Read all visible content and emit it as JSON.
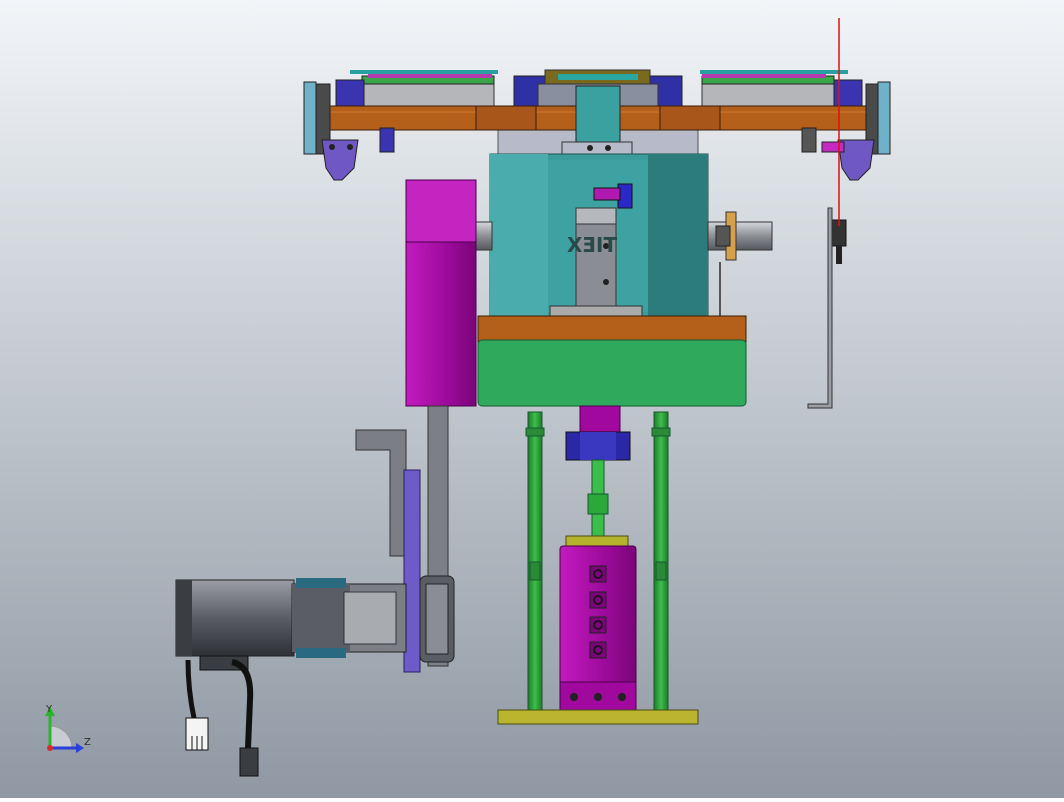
{
  "scene": {
    "background_top": "#f2f5f8",
    "background_bottom": "#8f98a3",
    "part_label": "TIEX"
  },
  "triad": {
    "y_label": "Y",
    "z_label": "Z",
    "y_color": "#2bb52b",
    "z_color": "#2a3fd9",
    "x_color": "#d92a2a"
  },
  "colors": {
    "rotary_plate": "#b45f1a",
    "body_teal": "#3b9c9c",
    "base_green": "#2faa5c",
    "magenta": "#a0089e",
    "column_green": "#2e9a3a",
    "violet": "#6c5bc9",
    "navy": "#2b28a8",
    "olive_base": "#b9b52e",
    "motor_dark": "#3a3d42",
    "motor_grey": "#7b7f85",
    "steel": "#8a8e93",
    "red_line": "#e01010"
  }
}
